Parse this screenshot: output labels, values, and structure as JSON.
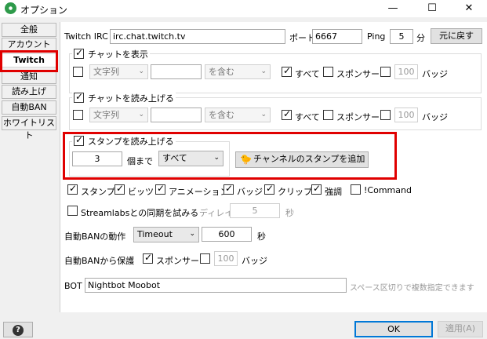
{
  "window": {
    "title": "オプション",
    "minimize": "—",
    "maximize": "☐",
    "close": "✕"
  },
  "nav": {
    "items": [
      "全般",
      "アカウント",
      "Twitch",
      "通知",
      "読み上げ",
      "自動BAN",
      "ホワイトリスト"
    ],
    "active": "Twitch"
  },
  "irc": {
    "label": "Twitch IRC",
    "server": "irc.chat.twitch.tv",
    "port_label": "ポート",
    "port": "6667",
    "ping_label": "Ping",
    "ping": "5",
    "ping_unit": "分",
    "reset_button": "元に戻す"
  },
  "chat_display": {
    "label": "チャットを表示",
    "checked": true,
    "filter": {
      "checked": false,
      "type": "文字列",
      "value": "",
      "condition": "を含む",
      "all_label": "すべて",
      "all_checked": true,
      "sponsor_label": "スポンサー",
      "sponsor_checked": false,
      "badge_count": "100",
      "badge_label": "バッジ",
      "badge_checked": false
    }
  },
  "chat_read": {
    "label": "チャットを読み上げる",
    "checked": true,
    "filter": {
      "checked": false,
      "type": "文字列",
      "value": "",
      "condition": "を含む",
      "all_label": "すべて",
      "all_checked": true,
      "sponsor_label": "スポンサー",
      "sponsor_checked": false,
      "badge_count": "100",
      "badge_label": "バッジ",
      "badge_checked": false
    }
  },
  "stamp_read": {
    "label": "スタンプを読み上げる",
    "checked": true,
    "count": "3",
    "count_unit": "個まで",
    "scope": "すべて",
    "add_channel_button": "チャンネルのスタンプを追加"
  },
  "read_items": [
    {
      "label": "スタンプ",
      "checked": true
    },
    {
      "label": "ビッツ",
      "checked": true
    },
    {
      "label": "アニメーション",
      "checked": true
    },
    {
      "label": "バッジ",
      "checked": true
    },
    {
      "label": "クリップ",
      "checked": true
    },
    {
      "label": "強調",
      "checked": true
    },
    {
      "label": "!Command",
      "checked": false
    }
  ],
  "streamlabs": {
    "label": "Streamlabsとの同期を試みる",
    "checked": false,
    "delay_label": "ディレイ",
    "delay": "5",
    "delay_unit": "秒"
  },
  "autoban": {
    "label": "自動BANの動作",
    "action": "Timeout",
    "duration": "600",
    "unit": "秒"
  },
  "autoban_protect": {
    "label": "自動BANから保護",
    "sponsor_label": "スポンサー",
    "sponsor_checked": true,
    "badge_checked": false,
    "badge_count": "100",
    "badge_label": "バッジ"
  },
  "bot": {
    "label": "BOT",
    "value": "Nightbot Moobot",
    "hint": "スペース区切りで複数指定できます"
  },
  "footer": {
    "help": "?",
    "ok": "OK",
    "apply": "適用(A)"
  },
  "colors": {
    "highlight": "#e00000",
    "ok_border": "#0078d7"
  }
}
